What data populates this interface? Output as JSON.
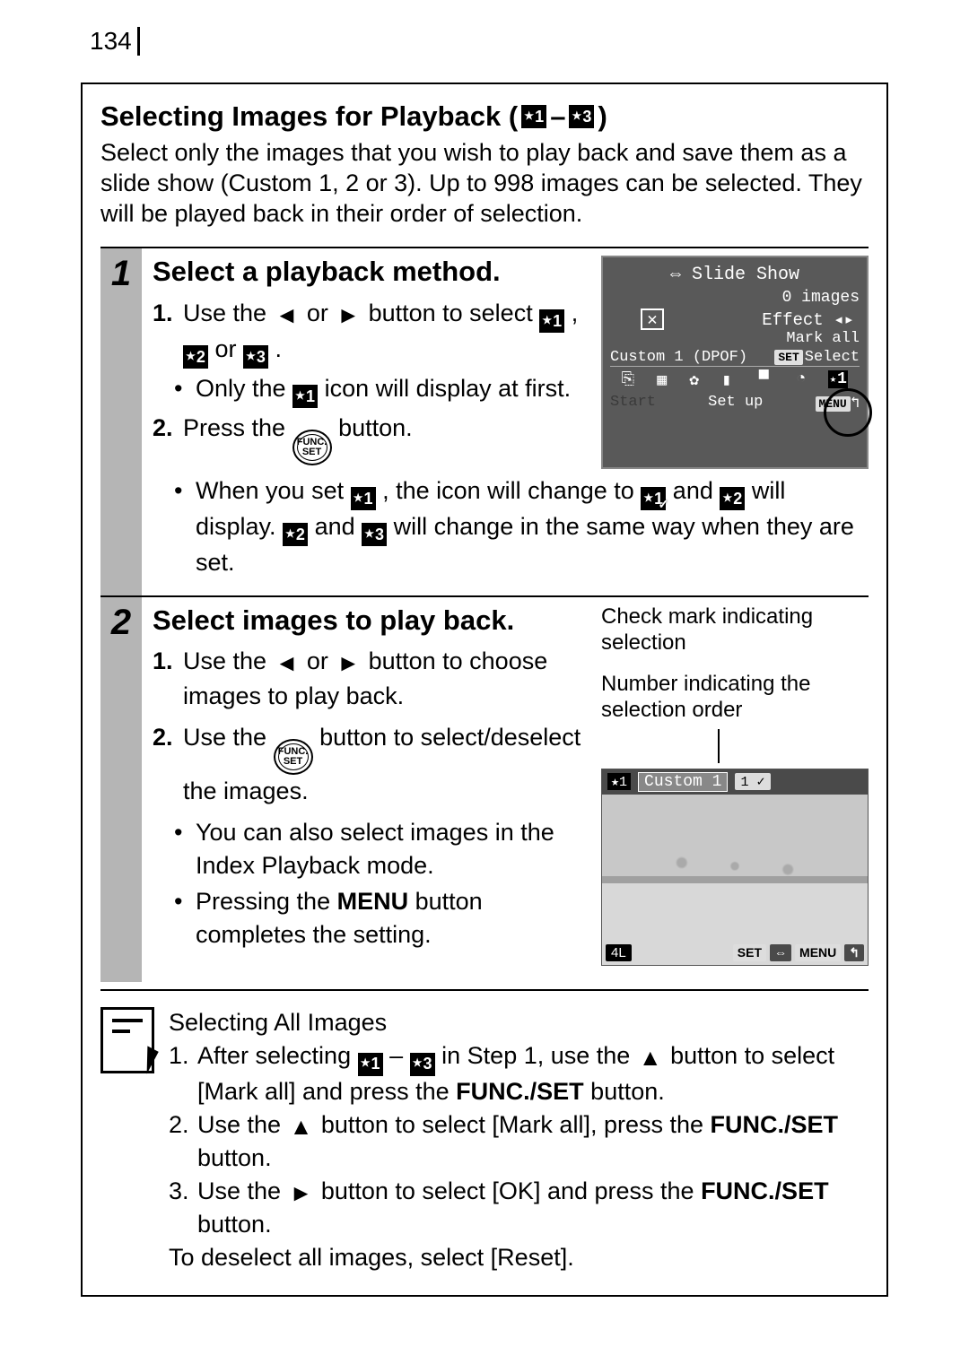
{
  "page_number": "134",
  "section_title_prefix": "Selecting Images for Playback (",
  "section_title_dash": " – ",
  "section_title_suffix": " )",
  "icon_star1": "★1",
  "icon_star2": "★2",
  "icon_star3": "★3",
  "icon_star1_checked": "★1✓",
  "intro": "Select only the images that you wish to play back and save them as a slide show (Custom 1, 2 or 3). Up to 998 images can be selected. They will be played back in their order of selection.",
  "step1": {
    "num": "1",
    "heading": "Select a playback method.",
    "line1_a": "Use the ",
    "line1_b": " or ",
    "line1_c": " button to select ",
    "line1_d": " , ",
    "line1_e": " or ",
    "line1_f": " .",
    "bullet1_a": "Only the ",
    "bullet1_b": " icon will display at first.",
    "line2_a": "Press the ",
    "line2_b": " button.",
    "fullbullet_a": "When you set ",
    "fullbullet_b": " , the icon will change to ",
    "fullbullet_c": " and ",
    "fullbullet_d": " will display. ",
    "fullbullet_e": " and ",
    "fullbullet_f": " will change in the same way when they are set.",
    "cam": {
      "title": "Slide Show",
      "images": "0 images",
      "effect": "Effect",
      "mark_all": "Mark all",
      "custom": "Custom 1 (DPOF)",
      "set": "SET",
      "select": "Select",
      "start": "Start",
      "setup": "Set up",
      "menu": "MENU"
    }
  },
  "step2": {
    "num": "2",
    "heading": "Select images to play back.",
    "caption1": "Check mark indicating selection",
    "caption2": "Number indicating the selection order",
    "line1_a": "Use the ",
    "line1_b": " or ",
    "line1_c": " button to choose images to play back.",
    "line2_a": "Use the ",
    "line2_b": " button to select/deselect the images.",
    "bullet1": "You can also select images in the Index Playback mode.",
    "bullet2_a": "Pressing the ",
    "bullet2_menu": "MENU",
    "bullet2_b": " button completes the setting.",
    "cam": {
      "star1": "★1",
      "custom": "Custom 1",
      "badge": "1 ✓",
      "bl": "4L",
      "set": "SET",
      "menu": "MENU"
    }
  },
  "notes": {
    "title": "Selecting All Images",
    "n1_a": "After selecting ",
    "n1_b": " – ",
    "n1_c": " in Step 1, use the ",
    "n1_d": " button to select [Mark all] and press the ",
    "n1_funcset": "FUNC./SET",
    "n1_e": " button.",
    "n2_a": "Use the ",
    "n2_b": " button to select [Mark all], press the ",
    "n2_funcset": "FUNC./SET",
    "n2_c": " button.",
    "n3_a": "Use the ",
    "n3_b": " button to select [OK] and press the ",
    "n3_funcset": "FUNC./SET",
    "n3_c": " button.",
    "footer": "To deselect all images, select [Reset]."
  },
  "glyphs": {
    "left": "←",
    "right": "→",
    "up": "↑",
    "funcset": "FUNC.\nSET"
  }
}
